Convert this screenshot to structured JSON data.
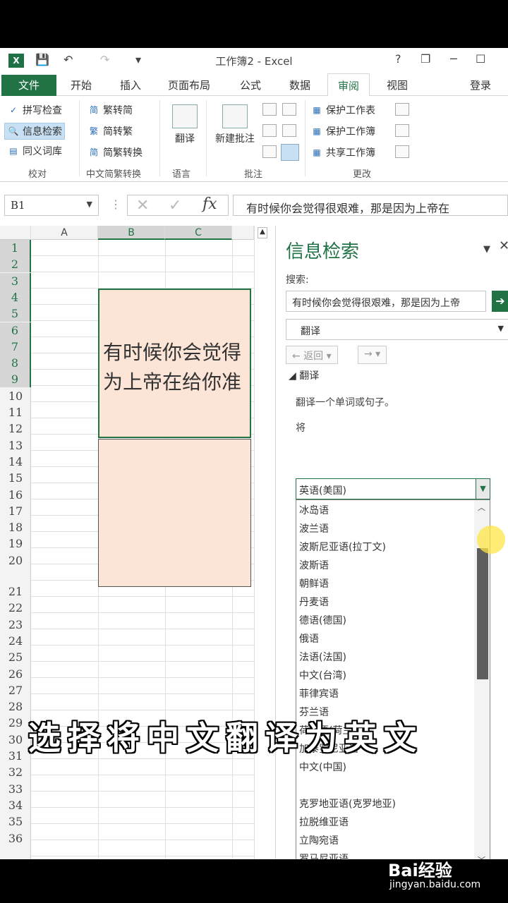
{
  "window": {
    "title": "工作簿2 - Excel",
    "help": "?",
    "minimize": "─",
    "maximize": "☐",
    "restore": "❐"
  },
  "quick_access": {
    "save": "💾",
    "undo": "↶",
    "redo": "↷",
    "customize": "▾"
  },
  "tabs": [
    "文件",
    "开始",
    "插入",
    "页面布局",
    "公式",
    "数据",
    "审阅",
    "视图"
  ],
  "active_tab": "审阅",
  "login": "登录",
  "ribbon": {
    "proofing": {
      "items": [
        "拼写检查",
        "信息检索",
        "同义词库"
      ],
      "label": "校对"
    },
    "chinese_conversion": {
      "items": [
        "繁转简",
        "简转繁",
        "简繁转换"
      ],
      "label": "中文简繁转换"
    },
    "language": {
      "button": "翻译",
      "label": "语言"
    },
    "comments": {
      "button": "新建批注",
      "label": "批注"
    },
    "changes": {
      "items": [
        "保护工作表",
        "保护工作簿",
        "共享工作簿"
      ],
      "label": "更改"
    }
  },
  "formula_bar": {
    "name_box": "B1",
    "cancel": "✕",
    "enter": "✓",
    "fx": "fx",
    "formula": "有时候你会觉得很艰难，那是因为上帝在"
  },
  "grid": {
    "columns": [
      "A",
      "B",
      "C"
    ],
    "rows": [
      "1",
      "2",
      "3",
      "4",
      "5",
      "6",
      "7",
      "8",
      "9",
      "10",
      "11",
      "12",
      "13",
      "14",
      "15",
      "16",
      "17",
      "18",
      "19",
      "20",
      "21",
      "22",
      "23",
      "24",
      "25",
      "26",
      "27",
      "28",
      "29",
      "30",
      "31",
      "32",
      "33",
      "34",
      "35",
      "36"
    ],
    "cell_text": "有时候你会觉得\n为上帝在给你准"
  },
  "research_pane": {
    "title": "信息检索",
    "search_label": "搜索:",
    "search_value": "有时候你会觉得很艰难，那是因为上帝",
    "service": "翻译",
    "back": "← 返回",
    "forward": "→",
    "section": "翻译",
    "description": "翻译一个单词或句子。",
    "from_label": "将",
    "selected_language": "英语(美国)",
    "language_options": [
      "冰岛语",
      "波兰语",
      "波斯尼亚语(拉丁文)",
      "波斯语",
      "朝鲜语",
      "丹麦语",
      "德语(德国)",
      "俄语",
      "法语(法国)",
      "中文(台湾)",
      "菲律宾语",
      "芬兰语",
      "荷兰语(荷兰)",
      "加泰罗尼亚语",
      "中文(中国)",
      "",
      "克罗地亚语(克罗地亚)",
      "拉脱维亚语",
      "立陶宛语",
      "罗马尼亚语"
    ]
  },
  "caption": "选择将中文翻译为英文",
  "watermark": {
    "brand": "Bai经验",
    "url": "jingyan.baidu.com"
  },
  "colors": {
    "excel_green": "#217346",
    "merged_fill": "#fce4d6",
    "cursor": "#ffe646"
  }
}
